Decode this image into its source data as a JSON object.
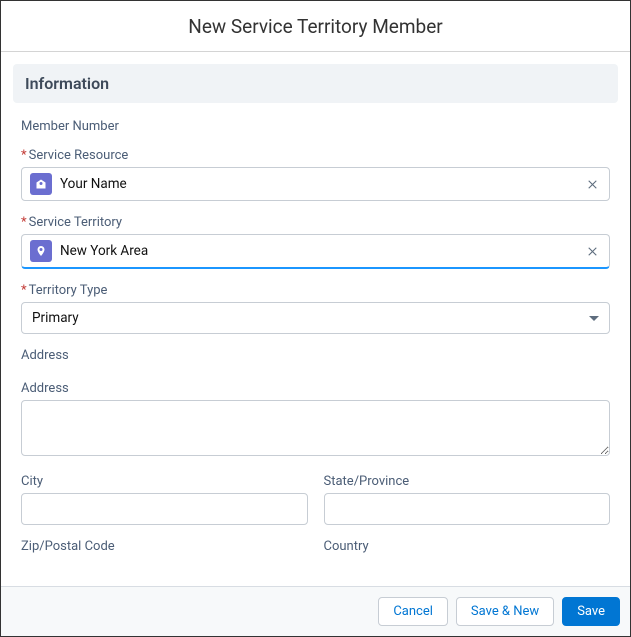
{
  "header": {
    "title": "New Service Territory Member"
  },
  "section": {
    "information": "Information"
  },
  "fields": {
    "member_number": {
      "label": "Member Number"
    },
    "service_resource": {
      "label": "Service Resource",
      "value": "Your Name"
    },
    "service_territory": {
      "label": "Service Territory",
      "value": "New York Area"
    },
    "territory_type": {
      "label": "Territory Type",
      "value": "Primary"
    },
    "address_section": {
      "label": "Address"
    },
    "address": {
      "label": "Address"
    },
    "city": {
      "label": "City"
    },
    "state": {
      "label": "State/Province"
    },
    "zip": {
      "label": "Zip/Postal Code"
    },
    "country": {
      "label": "Country"
    }
  },
  "footer": {
    "cancel": "Cancel",
    "save_new": "Save & New",
    "save": "Save"
  }
}
